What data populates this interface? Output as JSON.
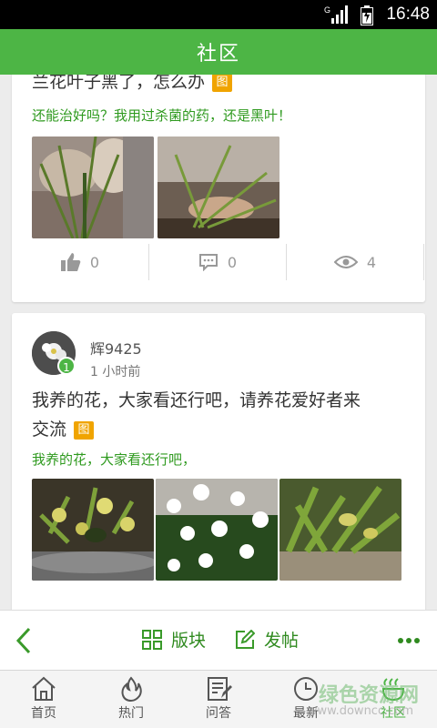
{
  "status_bar": {
    "network": "G",
    "time": "16:48"
  },
  "header": {
    "title": "社区"
  },
  "posts": [
    {
      "title": "兰花叶子黑了，怎么办",
      "image_tag": "图",
      "excerpt": "还能治好吗？我用过杀菌的药，还是黑叶！",
      "likes": "0",
      "comments": "0",
      "views": "4"
    },
    {
      "username": "辉9425",
      "level": "1",
      "time": "1 小时前",
      "title_line1": "我养的花，大家看还行吧，请养花爱好者来",
      "title_line2": "交流",
      "image_tag": "图",
      "excerpt": "我养的花，大家看还行吧，"
    }
  ],
  "toolbar": {
    "board_label": "版块",
    "post_label": "发帖"
  },
  "tabs": [
    {
      "label": "首页"
    },
    {
      "label": "热门"
    },
    {
      "label": "问答"
    },
    {
      "label": "最新"
    },
    {
      "label": "社区"
    }
  ],
  "watermark": {
    "text": "绿色资源网",
    "url": "www.downcc.com"
  },
  "colors": {
    "brand_green": "#4db545",
    "excerpt_green": "#2f9a1f",
    "tag_orange": "#f0a400"
  }
}
